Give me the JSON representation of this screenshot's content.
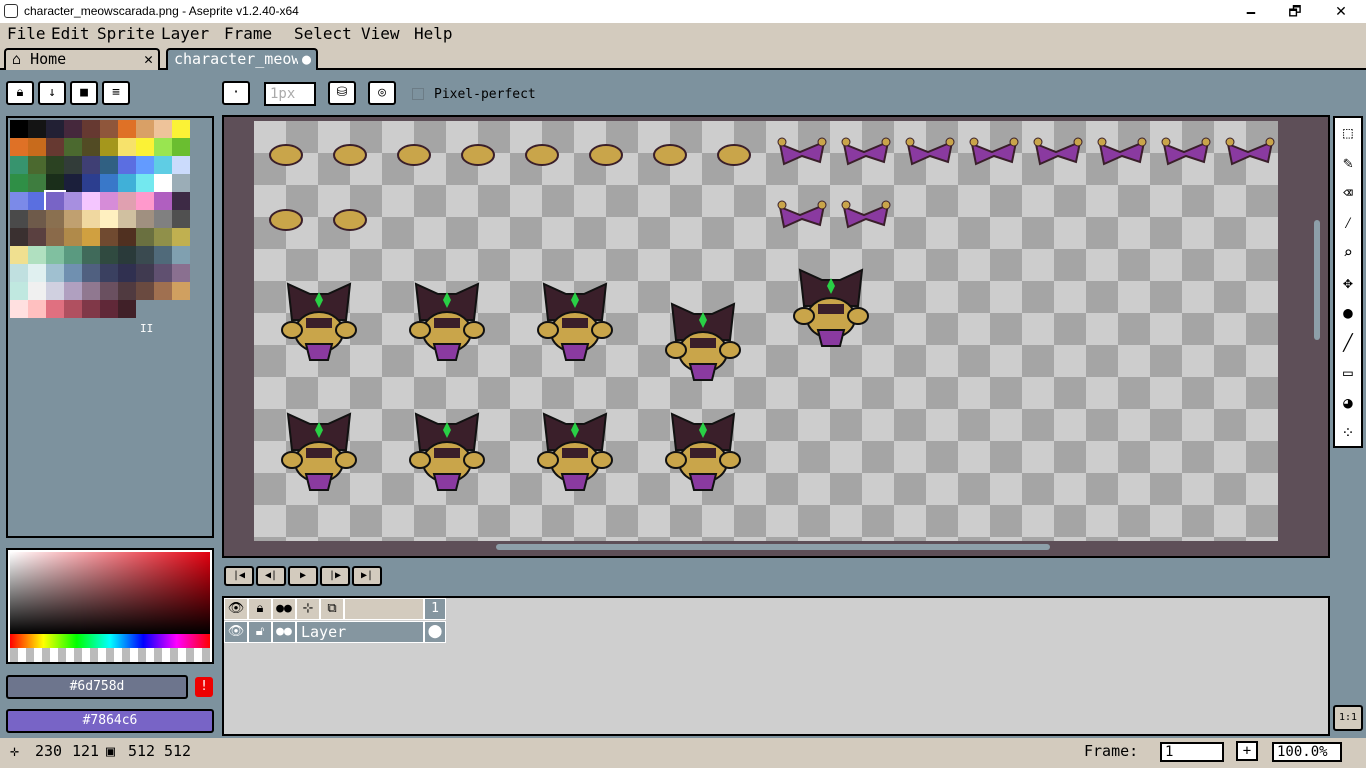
{
  "window": {
    "title": "character_meowscarada.png - Aseprite v1.2.40-x64",
    "minimize": "🗕",
    "maximize": "🗗",
    "close": "✕"
  },
  "menu": [
    "File",
    "Edit",
    "Sprite",
    "Layer",
    "Frame",
    "Select",
    "View",
    "Help"
  ],
  "tabs": {
    "home_label": "Home",
    "home_close": "✕",
    "file_label": "character_meowscarada.png",
    "file_modified_dot": "●"
  },
  "brush": {
    "size_value": "1px",
    "pixel_perfect_label": "Pixel-perfect",
    "pixel_perfect_checked": false
  },
  "palette": {
    "colors": [
      "#000000",
      "#141414",
      "#222034",
      "#45283c",
      "#663931",
      "#8f563b",
      "#df7126",
      "#d9a066",
      "#eec39a",
      "#fbf236",
      "#df7126",
      "#c86b1c",
      "#663931",
      "#4b692f",
      "#524b24",
      "#a5971c",
      "#f7e26b",
      "#fbf236",
      "#99e550",
      "#6abe30",
      "#37946e",
      "#4b692f",
      "#2b4222",
      "#323c39",
      "#3f3f74",
      "#306082",
      "#5b6ee1",
      "#639bff",
      "#5fcde4",
      "#cbdbfc",
      "#2f8f46",
      "#3e7d3f",
      "#1a2e1a",
      "#1b1f3b",
      "#2c3e8f",
      "#3978c9",
      "#40b0d8",
      "#73e8ef",
      "#ffffff",
      "#9badb7",
      "#7b8ae8",
      "#5a6fe0",
      "#7864c6",
      "#a78fe0",
      "#f4c6ff",
      "#d68cd8",
      "#e0a0b0",
      "#ff99cc",
      "#b05fc0",
      "#3d2a45",
      "#4a4a4a",
      "#6e5a4a",
      "#8a7050",
      "#c0a070",
      "#f0d8a0",
      "#fff0c0",
      "#d0c0a0",
      "#a09080",
      "#808080",
      "#505050",
      "#3a3030",
      "#5a4040",
      "#8a6a4a",
      "#b08a4a",
      "#d0a040",
      "#704a30",
      "#503020",
      "#6a7040",
      "#90904a",
      "#c0b050",
      "#f0e090",
      "#b0e0c0",
      "#80c0a0",
      "#5a9a80",
      "#406a5a",
      "#304a40",
      "#2a3a3a",
      "#3a4a50",
      "#506a7a",
      "#80a0b0",
      "#c0e0e0",
      "#e0f0f0",
      "#a0c0d0",
      "#7090b0",
      "#506080",
      "#3a4060",
      "#303050",
      "#403a50",
      "#605070",
      "#8a7090",
      "#c0e8e0",
      "#f0f0f0",
      "#d0d0e0",
      "#b0a0c0",
      "#907890",
      "#6a5060",
      "#503a40",
      "#6a4a40",
      "#a07050",
      "#d0a060",
      "#ffe0e0",
      "#ffc0c0",
      "#e07080",
      "#b05060",
      "#803848",
      "#602838",
      "#402028"
    ],
    "selected_index": 42,
    "marker": "II"
  },
  "colors": {
    "foreground_hex": "#6d758d",
    "background_hex": "#7864c6",
    "warning_icon": "!"
  },
  "timeline": {
    "frame_header": "1",
    "layers": [
      {
        "name": "Layer",
        "visible": true,
        "locked": false
      }
    ]
  },
  "status": {
    "cursor_icon": "✛",
    "cursor_x": "230",
    "cursor_y": "121",
    "size_icon": "▣",
    "sprite_w": "512",
    "sprite_h": "512",
    "frame_label": "Frame:",
    "frame_value": "1",
    "add_frame": "+",
    "zoom_value": "100.0%"
  },
  "tools": [
    "rect-marquee",
    "pencil",
    "eraser",
    "eyedropper",
    "zoom",
    "move",
    "paint-bucket",
    "line",
    "rectangle",
    "blur",
    "spray"
  ],
  "zoom_reset_label": "1:1",
  "theme": {
    "bg": "#7d929e",
    "panel": "#d3cbbe",
    "canvas_border": "#5e4f58",
    "sprite_body": "#c9a54a",
    "sprite_dark": "#3a1f2a",
    "sprite_purple": "#8a3aa0",
    "sprite_green": "#29d046"
  }
}
